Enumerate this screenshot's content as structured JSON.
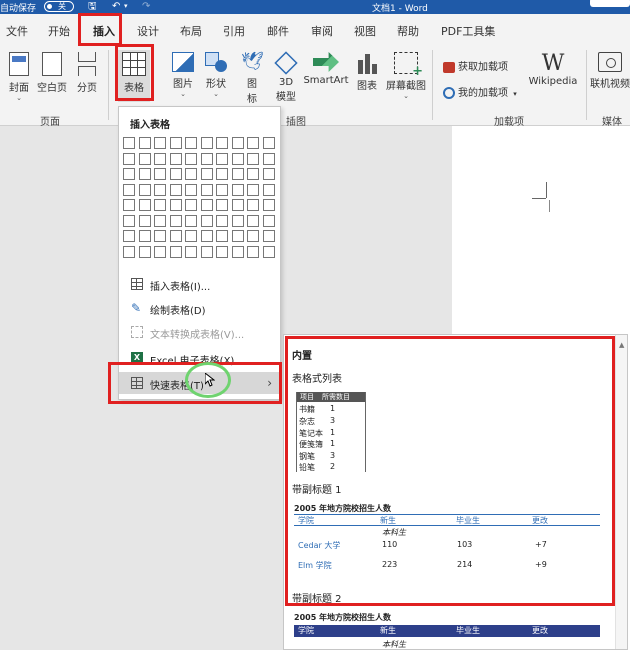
{
  "titlebar": {
    "autosave_label": "自动保存",
    "autosave_state": "关",
    "doc_title": "文档1 - Word"
  },
  "tabs": [
    "文件",
    "开始",
    "插入",
    "设计",
    "布局",
    "引用",
    "邮件",
    "审阅",
    "视图",
    "帮助",
    "PDF工具集"
  ],
  "ribbon": {
    "pages": {
      "cover": "封面",
      "blank": "空白页",
      "break": "分页",
      "group": "页面"
    },
    "table": {
      "label": "表格"
    },
    "illustrations": {
      "pictures": "图片",
      "shapes": "形状",
      "icons": "图\n标",
      "icons_line1": "图",
      "icons_line2": "标",
      "models_line1": "3D",
      "models_line2": "模型",
      "smartart": "SmartArt",
      "chart": "图表",
      "screenshot": "屏幕截图",
      "group": "插图"
    },
    "addins": {
      "get": "获取加载项",
      "my": "我的加载项",
      "wikipedia": "Wikipedia",
      "group": "加载项"
    },
    "media": {
      "online_video": "联机视频",
      "group": "媒体"
    }
  },
  "table_menu": {
    "title": "插入表格",
    "items": [
      {
        "label": "插入表格(I)...",
        "disabled": false
      },
      {
        "label": "绘制表格(D)",
        "disabled": false
      },
      {
        "label": "文本转换成表格(V)...",
        "disabled": true
      },
      {
        "label": "Excel 电子表格(X)",
        "disabled": false
      },
      {
        "label": "快速表格(T)",
        "disabled": false
      }
    ]
  },
  "quick_tables": {
    "builtin_label": "内置",
    "tabular_list": {
      "label": "表格式列表",
      "headers": [
        "项目",
        "所需数目"
      ],
      "rows": [
        [
          "书籍",
          "1"
        ],
        [
          "杂志",
          "3"
        ],
        [
          "笔记本",
          "1"
        ],
        [
          "便笺簿",
          "1"
        ],
        [
          "钢笔",
          "3"
        ],
        [
          "铅笔",
          "2"
        ]
      ]
    },
    "with_subheads_1": {
      "label": "带副标题 1",
      "title": "2005 年地方院校招生人数",
      "headers": [
        "学院",
        "新生",
        "毕业生",
        "更改"
      ],
      "subhead": "本科生",
      "rows": [
        [
          "Cedar 大学",
          "110",
          "103",
          "+7"
        ],
        [
          "Elm 学院",
          "223",
          "214",
          "+9"
        ]
      ]
    },
    "with_subheads_2": {
      "label": "带副标题 2",
      "title": "2005 年地方院校招生人数",
      "headers": [
        "学院",
        "新生",
        "毕业生",
        "更改"
      ],
      "subhead": "本科生"
    }
  }
}
